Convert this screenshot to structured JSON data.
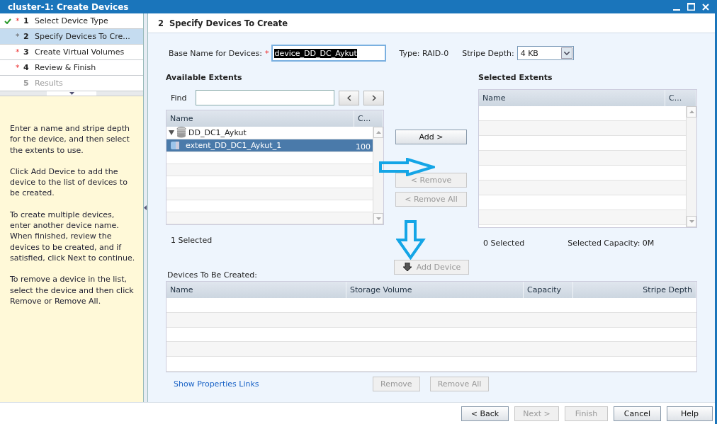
{
  "window": {
    "title": "cluster-1: Create Devices"
  },
  "steps": [
    {
      "marker": "*",
      "number": "1",
      "label": "Select Device Type",
      "completed": true,
      "selected": false,
      "disabled": false
    },
    {
      "marker": "*",
      "number": "2",
      "label": "Specify Devices To Cre...",
      "completed": false,
      "selected": true,
      "disabled": false
    },
    {
      "marker": "*",
      "number": "3",
      "label": "Create Virtual Volumes",
      "completed": false,
      "selected": false,
      "disabled": false
    },
    {
      "marker": "*",
      "number": "4",
      "label": "Review & Finish",
      "completed": false,
      "selected": false,
      "disabled": false
    },
    {
      "number": "5",
      "label": "Results",
      "completed": false,
      "selected": false,
      "disabled": true
    }
  ],
  "help_text": [
    "Enter a name and stripe depth for the device, and then select the extents to use.",
    "Click Add Device to add the device to the list of devices to be created.",
    "To create multiple devices, enter another device name. When finished, review the devices to be created, and if satisfied, click Next to continue.",
    "To remove a device in the list, select the device and then click Remove or Remove All."
  ],
  "page_title": "2  Specify Devices To Create",
  "form": {
    "base_name_label": "Base Name for Devices:",
    "required_mark": "*",
    "base_name_value": "device_DD_DC_Aykut",
    "type_text": "Type: RAID-0",
    "stripe_label": "Stripe Depth:",
    "stripe_value": "4 KB"
  },
  "available": {
    "title": "Available Extents",
    "find_label": "Find",
    "columns": [
      "Name",
      "C..."
    ],
    "rows": [
      {
        "name": "DD_DC1_Aykut",
        "expanded": true,
        "selected": false,
        "children": [
          {
            "name": "extent_DD_DC1_Aykut_1",
            "capacity": "100",
            "selected": true
          }
        ]
      }
    ],
    "status": "1 Selected"
  },
  "transfer_buttons": [
    {
      "label": "Add >",
      "disabled": false
    },
    {
      "label": "< Remove",
      "disabled": true
    },
    {
      "label": "< Remove All",
      "disabled": true
    }
  ],
  "add_device": {
    "label": "Add Device",
    "disabled": true
  },
  "selected_extents": {
    "title": "Selected Extents",
    "columns": [
      "Name",
      "C..."
    ],
    "status": "0 Selected",
    "capacity": "Selected Capacity: 0M"
  },
  "devices": {
    "title": "Devices To Be Created:",
    "columns": [
      "Name",
      "Storage Volume",
      "Capacity",
      "Stripe Depth"
    ],
    "link": "Show Properties Links",
    "buttons": [
      {
        "label": "Remove",
        "disabled": true
      },
      {
        "label": "Remove All",
        "disabled": true
      }
    ]
  },
  "footer_buttons": [
    {
      "label": "< Back",
      "disabled": false
    },
    {
      "label": "Next >",
      "disabled": true
    },
    {
      "label": "Finish",
      "disabled": true
    },
    {
      "label": "Cancel",
      "disabled": false
    },
    {
      "label": "Help",
      "disabled": false
    }
  ]
}
